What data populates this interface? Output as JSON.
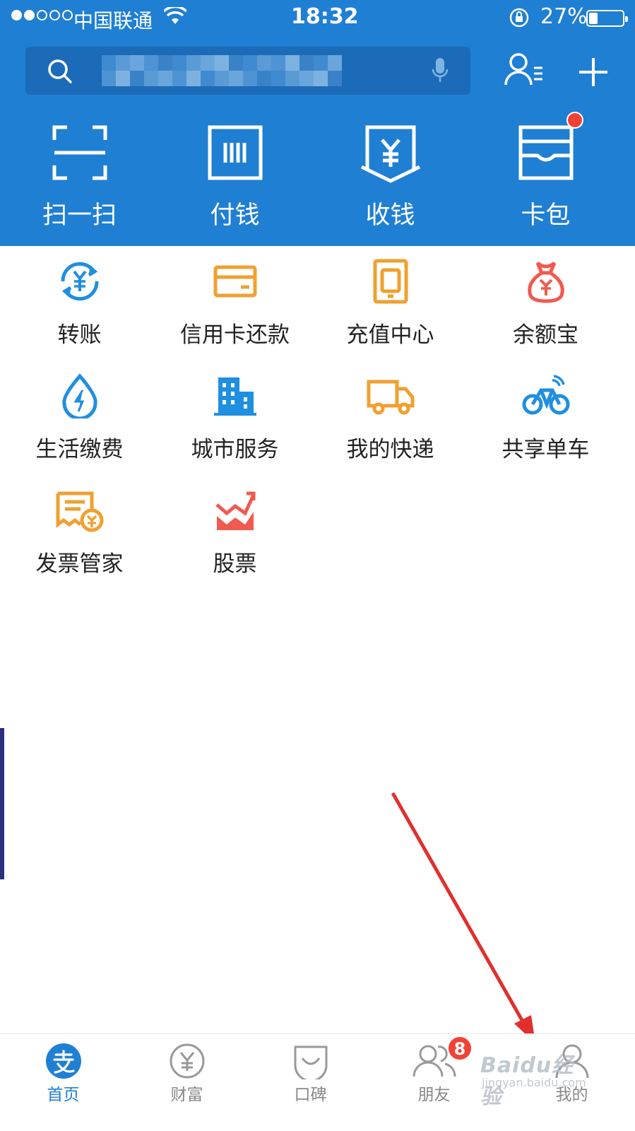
{
  "status_bar": {
    "carrier": "中国联通",
    "time": "18:32",
    "battery_percent": "27%",
    "battery_level": 0.27
  },
  "search": {
    "placeholder": ""
  },
  "quick_actions": [
    {
      "label": "扫一扫",
      "icon": "scan-icon"
    },
    {
      "label": "付钱",
      "icon": "pay-code-icon"
    },
    {
      "label": "收钱",
      "icon": "receive-money-icon"
    },
    {
      "label": "卡包",
      "icon": "card-wallet-icon",
      "has_dot": true
    }
  ],
  "services": [
    {
      "label": "转账",
      "icon": "transfer-icon",
      "color": "#1f8fe0"
    },
    {
      "label": "信用卡还款",
      "icon": "credit-card-icon",
      "color": "#f0a030"
    },
    {
      "label": "充值中心",
      "icon": "phone-recharge-icon",
      "color": "#f0a030"
    },
    {
      "label": "余额宝",
      "icon": "money-bag-icon",
      "color": "#f05a50"
    },
    {
      "label": "生活缴费",
      "icon": "utility-drop-icon",
      "color": "#1f8fe0"
    },
    {
      "label": "城市服务",
      "icon": "building-icon",
      "color": "#1f8fe0"
    },
    {
      "label": "我的快递",
      "icon": "delivery-truck-icon",
      "color": "#f0a030"
    },
    {
      "label": "共享单车",
      "icon": "bicycle-icon",
      "color": "#1f8fe0"
    },
    {
      "label": "发票管家",
      "icon": "invoice-icon",
      "color": "#f0a030"
    },
    {
      "label": "股票",
      "icon": "stock-chart-icon",
      "color": "#f05a50"
    }
  ],
  "tabs": [
    {
      "label": "首页",
      "icon": "home-alipay-icon",
      "active": true
    },
    {
      "label": "财富",
      "icon": "wealth-yuan-icon",
      "active": false
    },
    {
      "label": "口碑",
      "icon": "koubei-icon",
      "active": false
    },
    {
      "label": "朋友",
      "icon": "friends-icon",
      "active": false,
      "badge": "8"
    },
    {
      "label": "我的",
      "icon": "profile-icon",
      "active": false
    }
  ],
  "watermark": {
    "brand": "Baidu经验",
    "url": "jingyan.baidu.com"
  },
  "colors": {
    "header_blue": "#1f7fd3",
    "accent_red": "#f24236",
    "arrow_red": "#e0302e"
  }
}
